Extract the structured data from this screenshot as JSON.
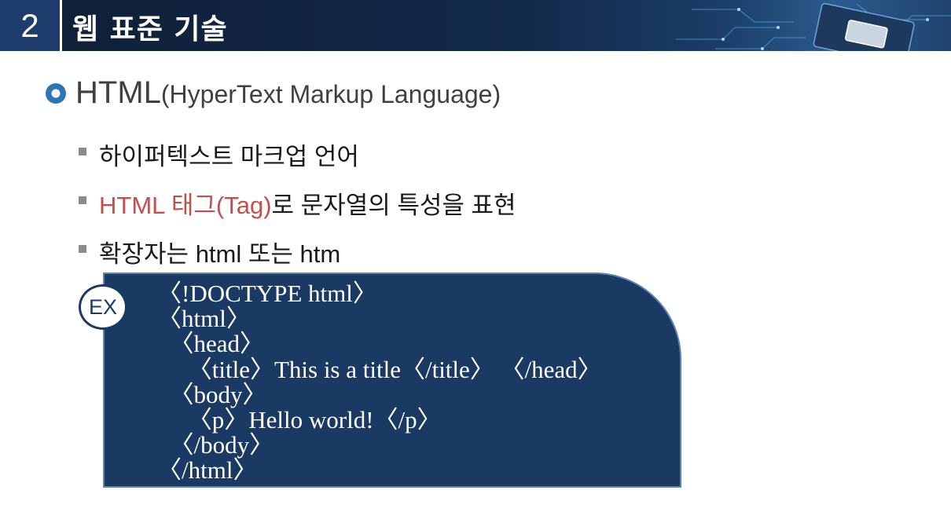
{
  "header": {
    "section_number": "2",
    "title": "웹 표준 기술"
  },
  "heading": {
    "main": "HTML",
    "paren": "(HyperText Markup Language)"
  },
  "bullets": [
    {
      "text": "하이퍼텍스트 마크업 언어"
    },
    {
      "red_part": "HTML 태그(Tag)",
      "text": "로 문자열의 특성을 표현"
    },
    {
      "text": "확장자는 html 또는 htm"
    }
  ],
  "example": {
    "badge": "EX",
    "code_lines": [
      "〈!DOCTYPE html〉",
      "〈html〉",
      "  〈head〉",
      "     〈title〉This is a title〈/title〉 〈/head〉",
      "  〈body〉",
      "     〈p〉Hello world!〈/p〉",
      "  〈/body〉",
      "〈/html〉"
    ]
  },
  "colors": {
    "header_bg": "#13294a",
    "number_box": "#1f3d6c",
    "code_bg": "#1b3a63",
    "accent_red": "#c0504d",
    "bullet_blue": "#2e75b6"
  }
}
